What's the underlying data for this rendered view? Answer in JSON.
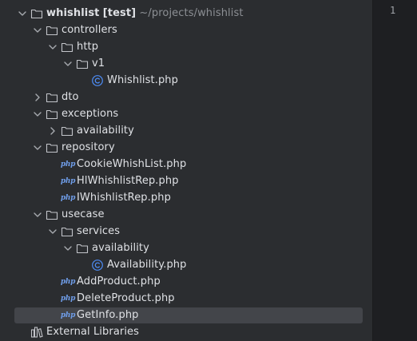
{
  "project_tree": {
    "items": [
      {
        "depth": 0,
        "expanded": true,
        "type": "root",
        "label": "whishlist",
        "badge": "[test]",
        "path": "~/projects/whishlist"
      },
      {
        "depth": 1,
        "expanded": true,
        "type": "folder",
        "label": "controllers"
      },
      {
        "depth": 2,
        "expanded": true,
        "type": "folder",
        "label": "http"
      },
      {
        "depth": 3,
        "expanded": true,
        "type": "folder",
        "label": "v1"
      },
      {
        "depth": 4,
        "type": "class",
        "label": "Whishlist.php"
      },
      {
        "depth": 1,
        "expanded": false,
        "type": "folder",
        "label": "dto"
      },
      {
        "depth": 1,
        "expanded": true,
        "type": "folder",
        "label": "exceptions"
      },
      {
        "depth": 2,
        "expanded": false,
        "type": "folder",
        "label": "availability"
      },
      {
        "depth": 1,
        "expanded": true,
        "type": "folder",
        "label": "repository"
      },
      {
        "depth": 2,
        "type": "php",
        "label": "CookieWhishList.php"
      },
      {
        "depth": 2,
        "type": "php",
        "label": "HlWhishlistRep.php"
      },
      {
        "depth": 2,
        "type": "php",
        "label": "IWhishlistRep.php"
      },
      {
        "depth": 1,
        "expanded": true,
        "type": "folder",
        "label": "usecase"
      },
      {
        "depth": 2,
        "expanded": true,
        "type": "folder",
        "label": "services"
      },
      {
        "depth": 3,
        "expanded": true,
        "type": "folder",
        "label": "availability"
      },
      {
        "depth": 4,
        "type": "class",
        "label": "Availability.php"
      },
      {
        "depth": 2,
        "type": "php",
        "label": "AddProduct.php"
      },
      {
        "depth": 2,
        "type": "php",
        "label": "DeleteProduct.php"
      },
      {
        "depth": 2,
        "type": "php",
        "label": "GetInfo.php",
        "selected": true
      },
      {
        "depth": 0,
        "type": "libraries",
        "label": "External Libraries"
      }
    ],
    "php_icon_text": "php",
    "colors": {
      "background": "#2b2d30",
      "selection": "#43454a",
      "text": "#dfe1e5",
      "muted": "#8c8f94",
      "php_icon": "#6f9de8",
      "class_icon": "#4d8cf5"
    }
  },
  "editor": {
    "line_number": "1",
    "background": "#1e1f22"
  }
}
